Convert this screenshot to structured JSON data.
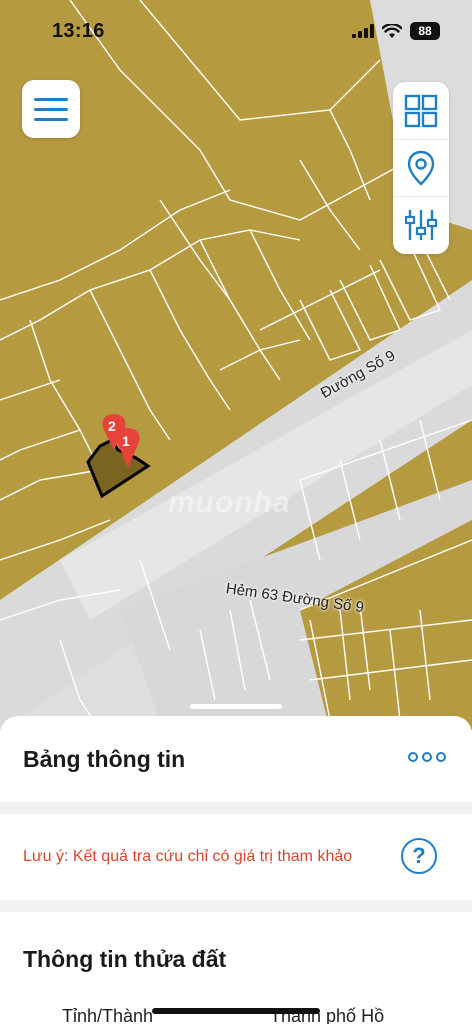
{
  "status_bar": {
    "time": "13:16",
    "battery": "88"
  },
  "map": {
    "road_label": "Đường Số 9",
    "alley_label": "Hẻm 63 Đường Số 9",
    "watermark": "muonha",
    "markers": [
      {
        "label": "2"
      },
      {
        "label": "1"
      }
    ],
    "colors": {
      "land": "#b59a40",
      "road": "#dddddd",
      "parcel_line": "#ffffff",
      "marker": "#e8433a"
    }
  },
  "toolbar": {
    "menu_icon": "hamburger-menu-icon",
    "tools": [
      {
        "icon": "grid-layers-icon"
      },
      {
        "icon": "location-pin-icon"
      },
      {
        "icon": "sliders-filter-icon"
      }
    ],
    "accent": "#1f7fc4"
  },
  "sheet": {
    "title": "Bảng thông tin",
    "note": "Lưu ý: Kết quả tra cứu chỉ có giá trị tham khảo",
    "help": "?",
    "parcel_title": "Thông tin thửa đất",
    "rows": [
      {
        "label": "Tỉnh/Thành",
        "value": "Thành phố Hồ"
      }
    ]
  }
}
